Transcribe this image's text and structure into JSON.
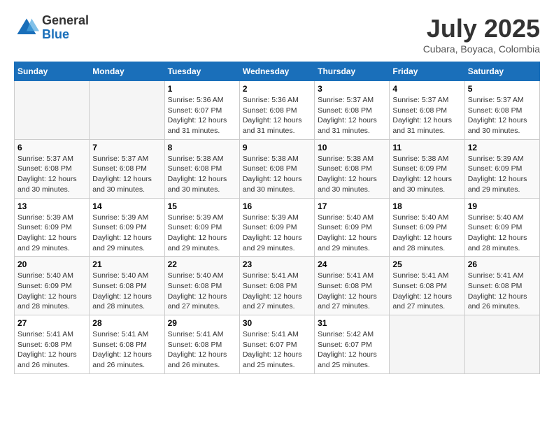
{
  "header": {
    "logo_general": "General",
    "logo_blue": "Blue",
    "month": "July 2025",
    "location": "Cubara, Boyaca, Colombia"
  },
  "days_of_week": [
    "Sunday",
    "Monday",
    "Tuesday",
    "Wednesday",
    "Thursday",
    "Friday",
    "Saturday"
  ],
  "weeks": [
    [
      {
        "day": "",
        "info": ""
      },
      {
        "day": "",
        "info": ""
      },
      {
        "day": "1",
        "info": "Sunrise: 5:36 AM\nSunset: 6:07 PM\nDaylight: 12 hours and 31 minutes."
      },
      {
        "day": "2",
        "info": "Sunrise: 5:36 AM\nSunset: 6:08 PM\nDaylight: 12 hours and 31 minutes."
      },
      {
        "day": "3",
        "info": "Sunrise: 5:37 AM\nSunset: 6:08 PM\nDaylight: 12 hours and 31 minutes."
      },
      {
        "day": "4",
        "info": "Sunrise: 5:37 AM\nSunset: 6:08 PM\nDaylight: 12 hours and 31 minutes."
      },
      {
        "day": "5",
        "info": "Sunrise: 5:37 AM\nSunset: 6:08 PM\nDaylight: 12 hours and 30 minutes."
      }
    ],
    [
      {
        "day": "6",
        "info": "Sunrise: 5:37 AM\nSunset: 6:08 PM\nDaylight: 12 hours and 30 minutes."
      },
      {
        "day": "7",
        "info": "Sunrise: 5:37 AM\nSunset: 6:08 PM\nDaylight: 12 hours and 30 minutes."
      },
      {
        "day": "8",
        "info": "Sunrise: 5:38 AM\nSunset: 6:08 PM\nDaylight: 12 hours and 30 minutes."
      },
      {
        "day": "9",
        "info": "Sunrise: 5:38 AM\nSunset: 6:08 PM\nDaylight: 12 hours and 30 minutes."
      },
      {
        "day": "10",
        "info": "Sunrise: 5:38 AM\nSunset: 6:08 PM\nDaylight: 12 hours and 30 minutes."
      },
      {
        "day": "11",
        "info": "Sunrise: 5:38 AM\nSunset: 6:09 PM\nDaylight: 12 hours and 30 minutes."
      },
      {
        "day": "12",
        "info": "Sunrise: 5:39 AM\nSunset: 6:09 PM\nDaylight: 12 hours and 29 minutes."
      }
    ],
    [
      {
        "day": "13",
        "info": "Sunrise: 5:39 AM\nSunset: 6:09 PM\nDaylight: 12 hours and 29 minutes."
      },
      {
        "day": "14",
        "info": "Sunrise: 5:39 AM\nSunset: 6:09 PM\nDaylight: 12 hours and 29 minutes."
      },
      {
        "day": "15",
        "info": "Sunrise: 5:39 AM\nSunset: 6:09 PM\nDaylight: 12 hours and 29 minutes."
      },
      {
        "day": "16",
        "info": "Sunrise: 5:39 AM\nSunset: 6:09 PM\nDaylight: 12 hours and 29 minutes."
      },
      {
        "day": "17",
        "info": "Sunrise: 5:40 AM\nSunset: 6:09 PM\nDaylight: 12 hours and 29 minutes."
      },
      {
        "day": "18",
        "info": "Sunrise: 5:40 AM\nSunset: 6:09 PM\nDaylight: 12 hours and 28 minutes."
      },
      {
        "day": "19",
        "info": "Sunrise: 5:40 AM\nSunset: 6:09 PM\nDaylight: 12 hours and 28 minutes."
      }
    ],
    [
      {
        "day": "20",
        "info": "Sunrise: 5:40 AM\nSunset: 6:09 PM\nDaylight: 12 hours and 28 minutes."
      },
      {
        "day": "21",
        "info": "Sunrise: 5:40 AM\nSunset: 6:08 PM\nDaylight: 12 hours and 28 minutes."
      },
      {
        "day": "22",
        "info": "Sunrise: 5:40 AM\nSunset: 6:08 PM\nDaylight: 12 hours and 27 minutes."
      },
      {
        "day": "23",
        "info": "Sunrise: 5:41 AM\nSunset: 6:08 PM\nDaylight: 12 hours and 27 minutes."
      },
      {
        "day": "24",
        "info": "Sunrise: 5:41 AM\nSunset: 6:08 PM\nDaylight: 12 hours and 27 minutes."
      },
      {
        "day": "25",
        "info": "Sunrise: 5:41 AM\nSunset: 6:08 PM\nDaylight: 12 hours and 27 minutes."
      },
      {
        "day": "26",
        "info": "Sunrise: 5:41 AM\nSunset: 6:08 PM\nDaylight: 12 hours and 26 minutes."
      }
    ],
    [
      {
        "day": "27",
        "info": "Sunrise: 5:41 AM\nSunset: 6:08 PM\nDaylight: 12 hours and 26 minutes."
      },
      {
        "day": "28",
        "info": "Sunrise: 5:41 AM\nSunset: 6:08 PM\nDaylight: 12 hours and 26 minutes."
      },
      {
        "day": "29",
        "info": "Sunrise: 5:41 AM\nSunset: 6:08 PM\nDaylight: 12 hours and 26 minutes."
      },
      {
        "day": "30",
        "info": "Sunrise: 5:41 AM\nSunset: 6:07 PM\nDaylight: 12 hours and 25 minutes."
      },
      {
        "day": "31",
        "info": "Sunrise: 5:42 AM\nSunset: 6:07 PM\nDaylight: 12 hours and 25 minutes."
      },
      {
        "day": "",
        "info": ""
      },
      {
        "day": "",
        "info": ""
      }
    ]
  ]
}
